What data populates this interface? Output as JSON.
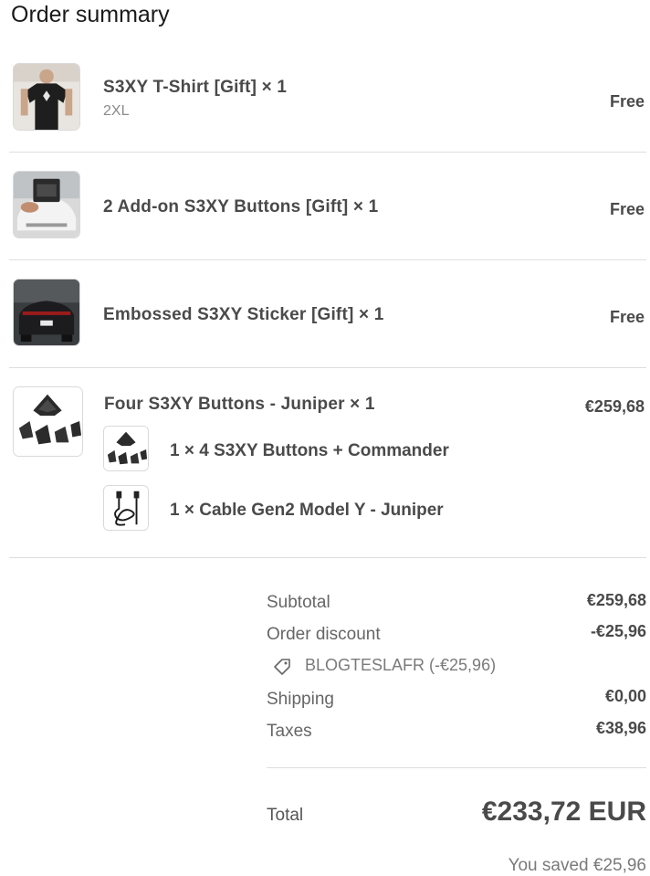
{
  "title": "Order summary",
  "items": [
    {
      "name": "S3XY T-Shirt [Gift] × 1",
      "variant": "2XL",
      "price": "Free",
      "thumb_icon": "tshirt-photo"
    },
    {
      "name": "2 Add-on S3XY Buttons [Gift] × 1",
      "price": "Free",
      "thumb_icon": "car-buttons-photo"
    },
    {
      "name": "Embossed S3XY Sticker [Gift] × 1",
      "price": "Free",
      "thumb_icon": "car-rear-photo"
    },
    {
      "name": "Four S3XY Buttons - Juniper × 1",
      "price": "€259,68",
      "thumb_icon": "buttons-photo",
      "components": [
        {
          "name": "1 × 4 S3XY Buttons + Commander",
          "thumb_icon": "buttons-photo"
        },
        {
          "name": "1 × Cable Gen2 Model Y - Juniper",
          "thumb_icon": "cable-photo"
        }
      ]
    }
  ],
  "summary": {
    "subtotal_label": "Subtotal",
    "subtotal_value": "€259,68",
    "discount_label": "Order discount",
    "discount_value": "-€25,96",
    "discount_code": "BLOGTESLAFR (-€25,96)",
    "shipping_label": "Shipping",
    "shipping_value": "€0,00",
    "taxes_label": "Taxes",
    "taxes_value": "€38,96",
    "total_label": "Total",
    "total_value": "€233,72 EUR",
    "saved": "You saved €25,96"
  }
}
